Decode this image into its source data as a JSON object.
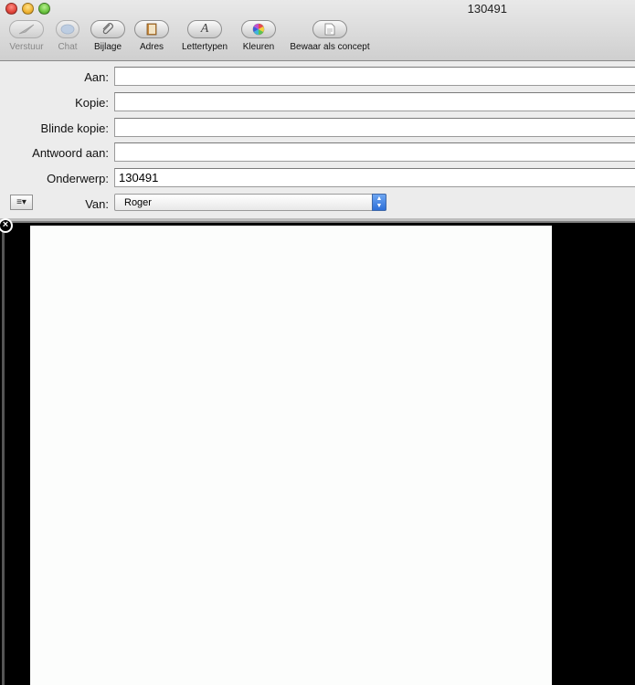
{
  "window": {
    "title": "130491"
  },
  "toolbar": {
    "send": "Verstuur",
    "chat": "Chat",
    "attachment": "Bijlage",
    "address": "Adres",
    "fonts": "Lettertypen",
    "colors": "Kleuren",
    "save_draft": "Bewaar als concept"
  },
  "header": {
    "to_label": "Aan:",
    "to_value": "",
    "cc_label": "Kopie:",
    "cc_value": "",
    "bcc_label": "Blinde kopie:",
    "bcc_value": "",
    "reply_to_label": "Antwoord aan:",
    "reply_to_value": "",
    "subject_label": "Onderwerp:",
    "subject_value": "130491",
    "from_label": "Van:",
    "from_value": "Roger",
    "format_menu_glyph": "≡▾"
  },
  "colors": {
    "close": "#e0443a",
    "minimize": "#efb232",
    "zoom": "#6ac33f",
    "stepper": "#2d6fd8"
  }
}
